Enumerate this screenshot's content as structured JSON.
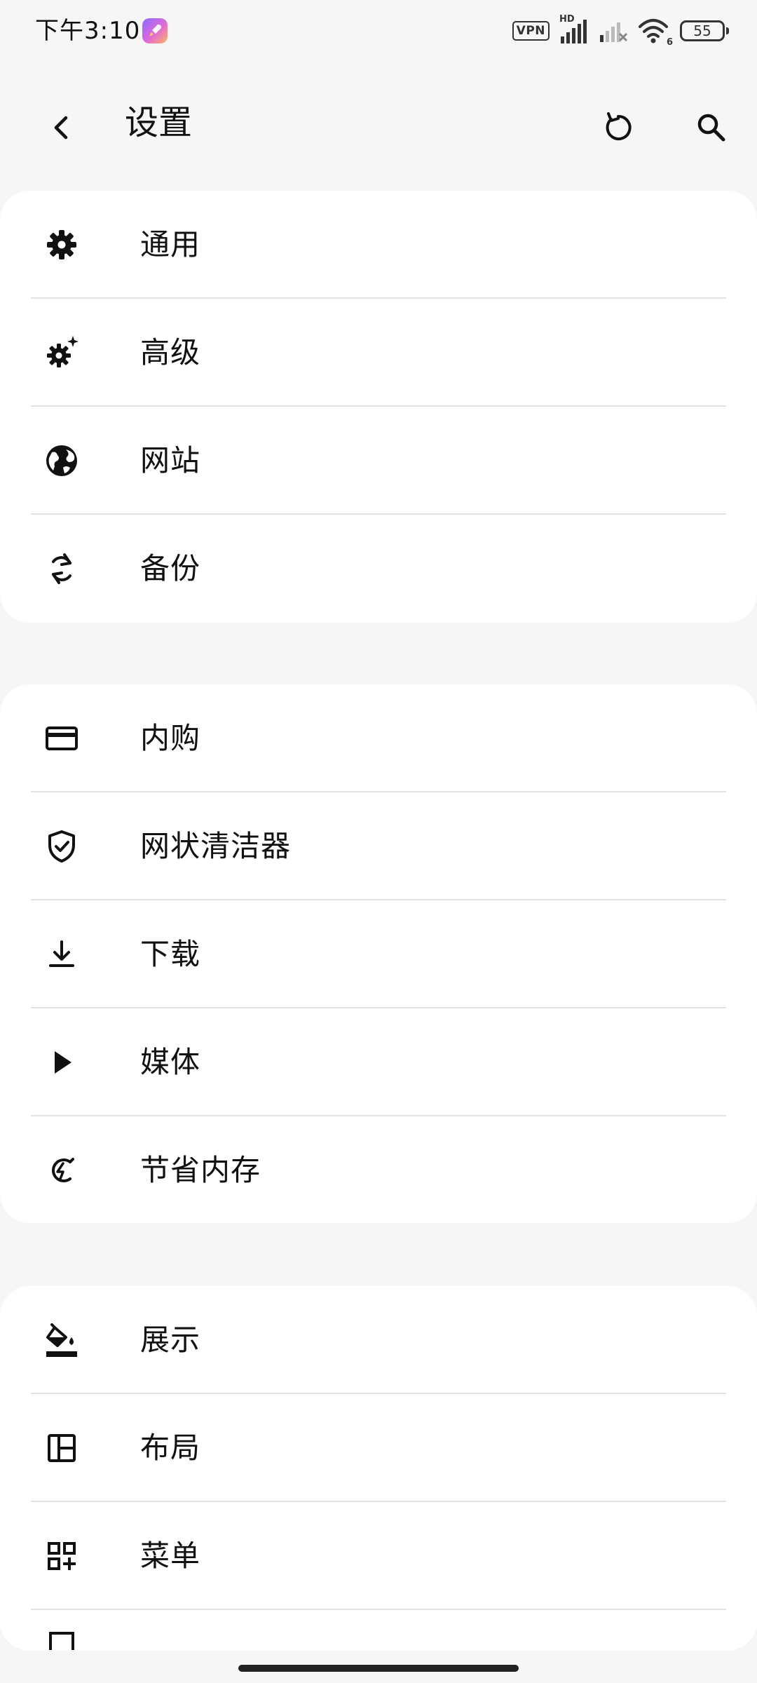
{
  "status_bar": {
    "time": "下午3:10",
    "vpn": "VPN",
    "network_hd": "HD",
    "wifi_generation": "6",
    "battery": "55"
  },
  "app_bar": {
    "title": "设置",
    "back_icon": "chevron-left-icon",
    "refresh_icon": "refresh-icon",
    "search_icon": "search-icon"
  },
  "groups": [
    {
      "items": [
        {
          "label": "通用",
          "icon": "gear-icon"
        },
        {
          "label": "高级",
          "icon": "gear-sparkle-icon"
        },
        {
          "label": "网站",
          "icon": "globe-icon"
        },
        {
          "label": "备份",
          "icon": "sync-icon"
        }
      ]
    },
    {
      "items": [
        {
          "label": "内购",
          "icon": "credit-card-icon"
        },
        {
          "label": "网状清洁器",
          "icon": "shield-check-icon"
        },
        {
          "label": "下载",
          "icon": "download-icon"
        },
        {
          "label": "媒体",
          "icon": "play-icon"
        },
        {
          "label": "节省内存",
          "icon": "memory-saver-icon"
        }
      ]
    },
    {
      "items": [
        {
          "label": "展示",
          "icon": "paint-bucket-icon"
        },
        {
          "label": "布局",
          "icon": "layout-icon"
        },
        {
          "label": "菜单",
          "icon": "menu-grid-icon"
        }
      ]
    }
  ],
  "colors": {
    "background": "#f6f6f6",
    "card": "#ffffff",
    "divider": "#e2e2e2",
    "text": "#111111"
  }
}
